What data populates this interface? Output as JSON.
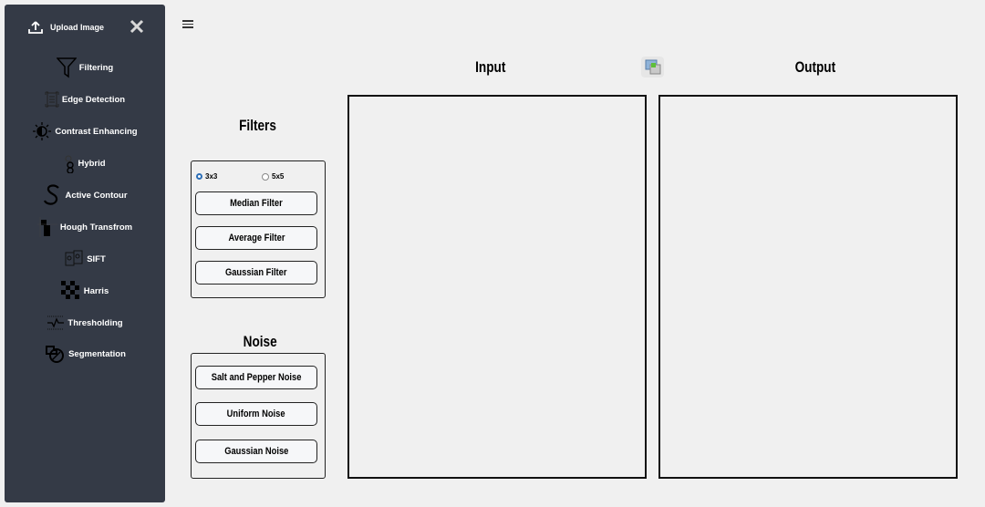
{
  "sidebar": {
    "upload_label": "Upload Image",
    "items": [
      {
        "label": "Filtering",
        "icon": "funnel-icon"
      },
      {
        "label": "Edge Detection",
        "icon": "document-scan-icon"
      },
      {
        "label": "Contrast Enhancing",
        "icon": "contrast-sun-icon"
      },
      {
        "label": "Hybrid",
        "icon": "hybrid-icon"
      },
      {
        "label": "Active Contour",
        "icon": "curve-s-icon"
      },
      {
        "label": "Hough Transfrom",
        "icon": "hough-icon"
      },
      {
        "label": "SIFT",
        "icon": "sift-icon"
      },
      {
        "label": "Harris",
        "icon": "checkerboard-icon"
      },
      {
        "label": "Thresholding",
        "icon": "threshold-icon"
      },
      {
        "label": "Segmentation",
        "icon": "segmentation-icon"
      }
    ]
  },
  "filters": {
    "title": "Filters",
    "kernel_options": [
      {
        "label": "3x3",
        "selected": true
      },
      {
        "label": "5x5",
        "selected": false
      }
    ],
    "buttons": [
      "Median Filter",
      "Average Filter",
      "Gaussian Filter"
    ]
  },
  "noise": {
    "title": "Noise",
    "buttons": [
      "Salt and Pepper Noise",
      "Uniform Noise",
      "Gaussian Noise"
    ]
  },
  "viewer": {
    "input_title": "Input",
    "output_title": "Output"
  },
  "colors": {
    "sidebar_bg": "#343a46",
    "radio_accent": "#2d6fb7",
    "page_bg": "#f0f0f0"
  }
}
